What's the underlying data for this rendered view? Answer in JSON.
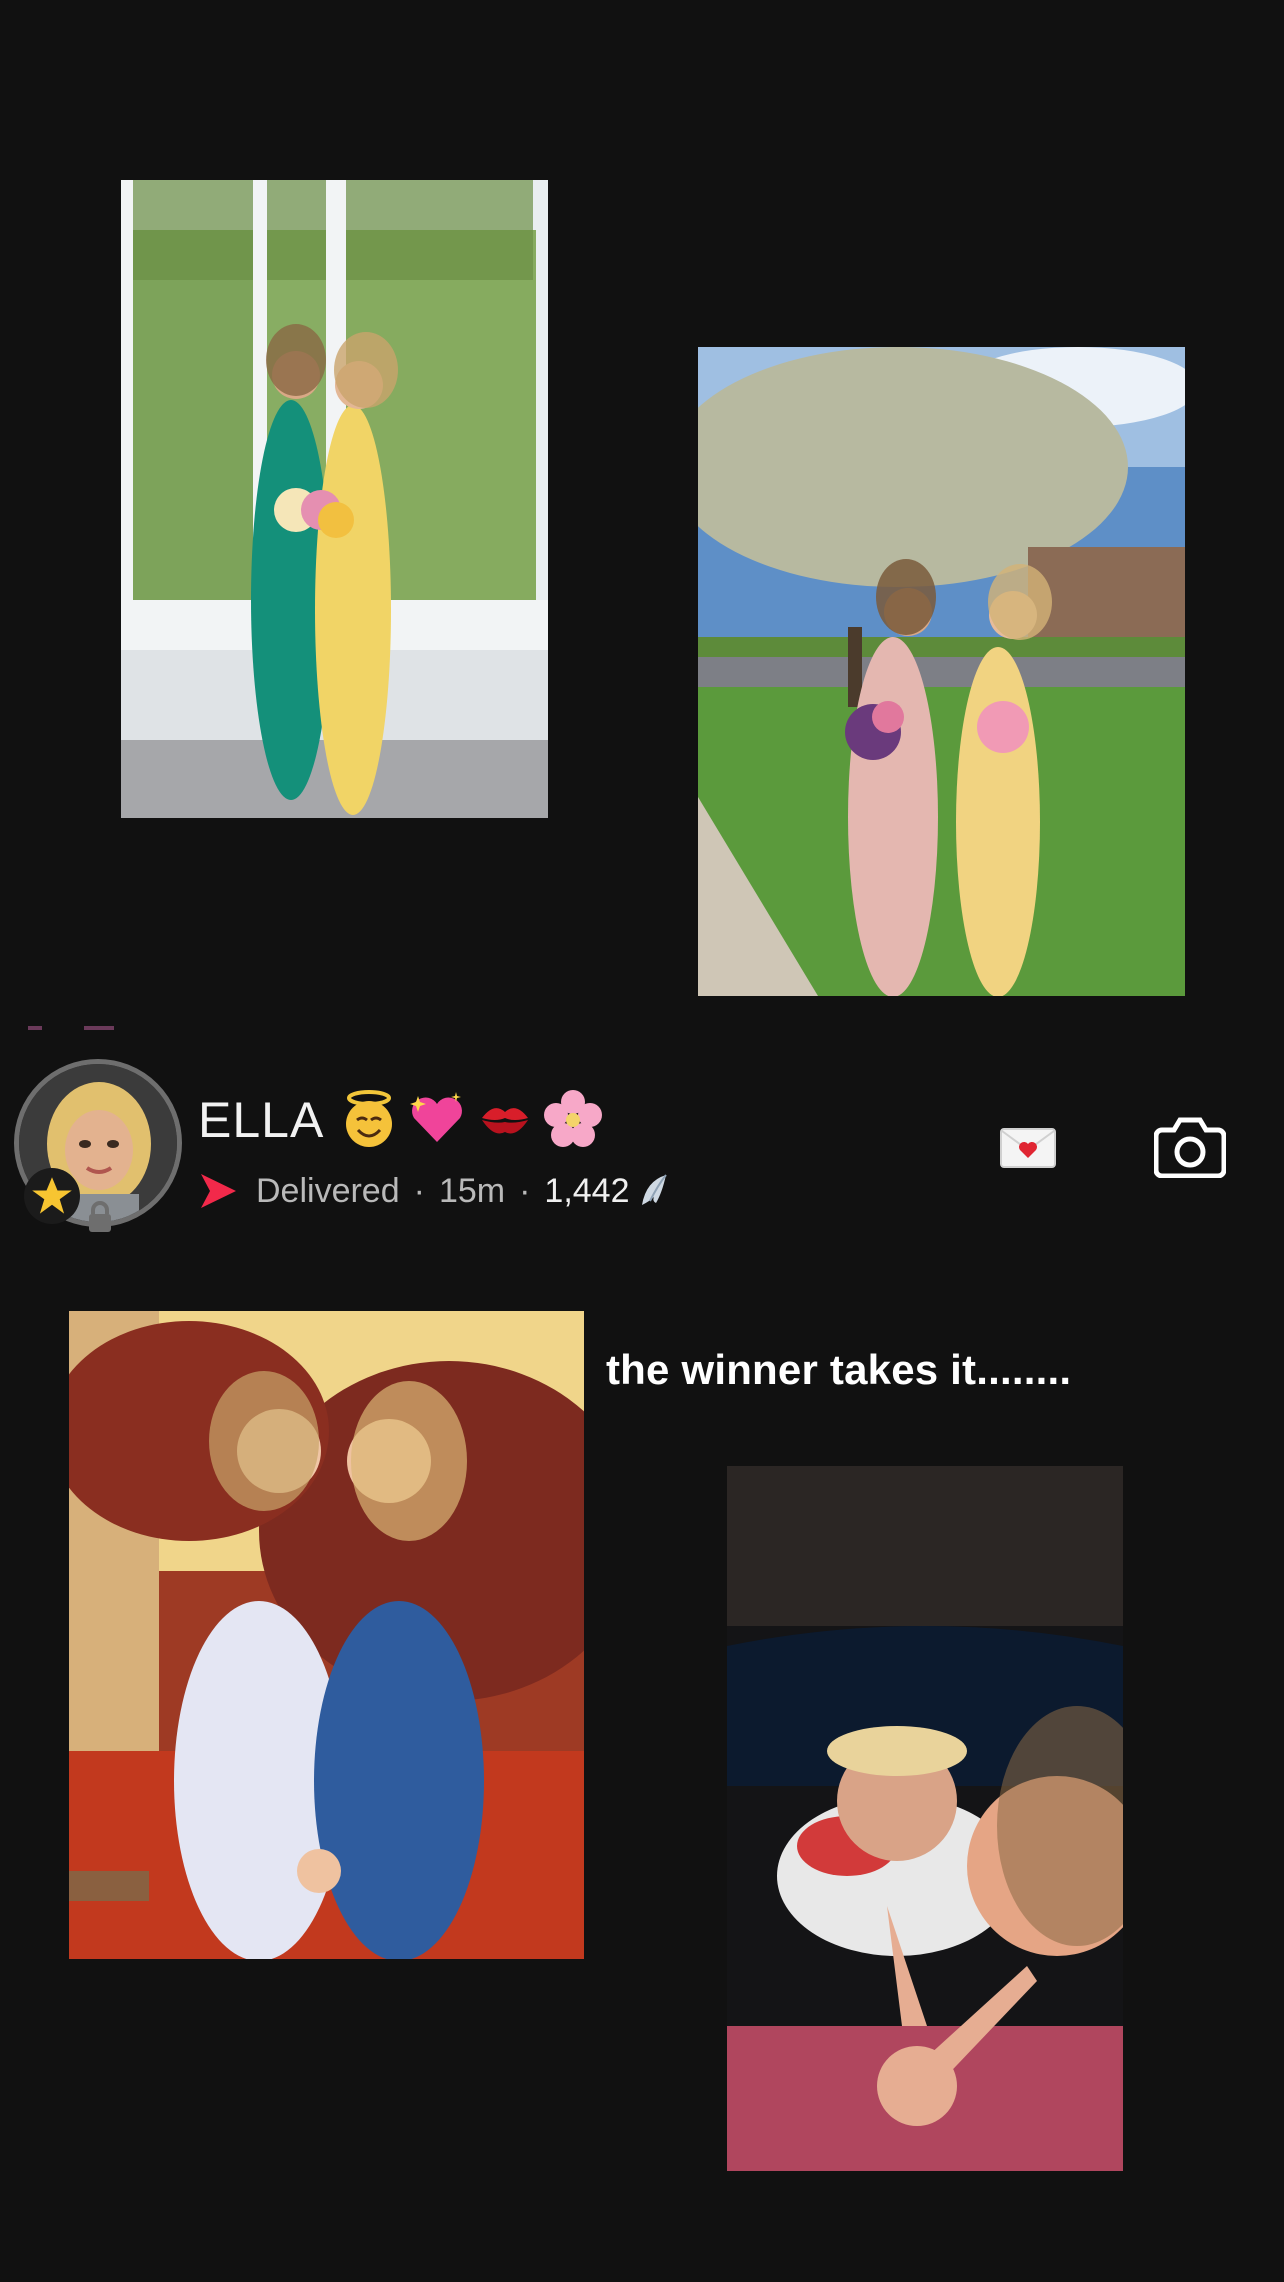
{
  "story": {
    "username": "ELLA",
    "name_emojis": [
      "smiling-face-with-halo",
      "sparkling-heart",
      "kiss-mark",
      "cherry-blossom"
    ],
    "status": "Delivered",
    "time_ago": "15m",
    "view_count": "1,442",
    "caption": "the winner takes it........"
  },
  "colors": {
    "background": "#111111",
    "status_arrow": "#f2294a",
    "text_secondary": "#b9b9b9"
  },
  "photos": [
    {
      "name": "photo-prom-window",
      "description_icon": "photo"
    },
    {
      "name": "photo-prom-tree",
      "description_icon": "photo"
    },
    {
      "name": "photo-sunset-dresses",
      "description_icon": "photo"
    },
    {
      "name": "photo-car-selfie",
      "description_icon": "photo"
    }
  ]
}
